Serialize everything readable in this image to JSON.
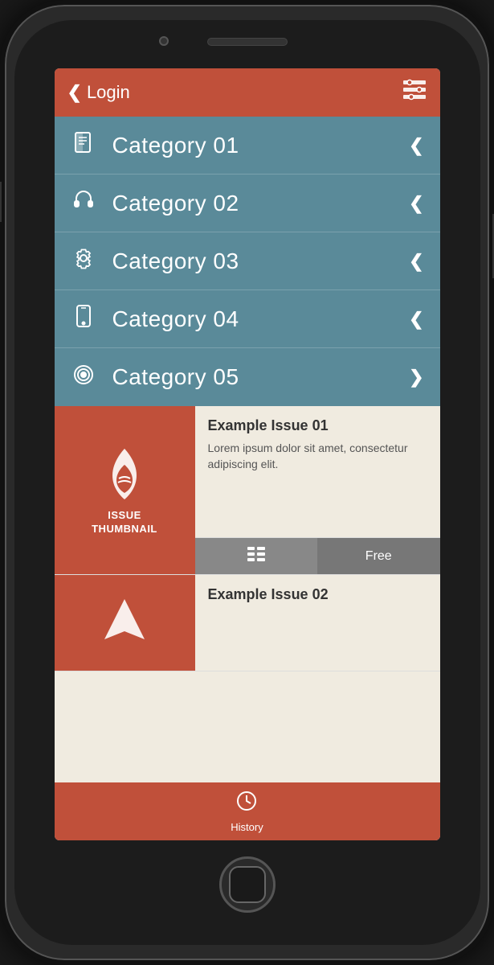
{
  "header": {
    "back_label": "Login",
    "settings_icon": "settings-icon"
  },
  "categories": [
    {
      "id": 1,
      "label": "Category 01",
      "icon": "book-icon",
      "arrow": "left",
      "expanded": false
    },
    {
      "id": 2,
      "label": "Category 02",
      "icon": "headphone-icon",
      "arrow": "left",
      "expanded": false
    },
    {
      "id": 3,
      "label": "Category 03",
      "icon": "gear-icon",
      "arrow": "left",
      "expanded": false
    },
    {
      "id": 4,
      "label": "Category 04",
      "icon": "phone-icon",
      "arrow": "left",
      "expanded": false
    },
    {
      "id": 5,
      "label": "Category 05",
      "icon": "target-icon",
      "arrow": "down",
      "expanded": true
    }
  ],
  "issues": [
    {
      "id": 1,
      "title": "Example Issue 01",
      "description": "Lorem ipsum dolor sit amet, consectetur adipiscing elit.",
      "thumbnail_line1": "ISSUE",
      "thumbnail_line2": "THUMBNAIL",
      "price_label": "Free"
    },
    {
      "id": 2,
      "title": "Example Issue 02",
      "description": "",
      "thumbnail_line1": "",
      "thumbnail_line2": ""
    }
  ],
  "tabbar": {
    "history_label": "History",
    "history_icon": "clock-icon"
  }
}
